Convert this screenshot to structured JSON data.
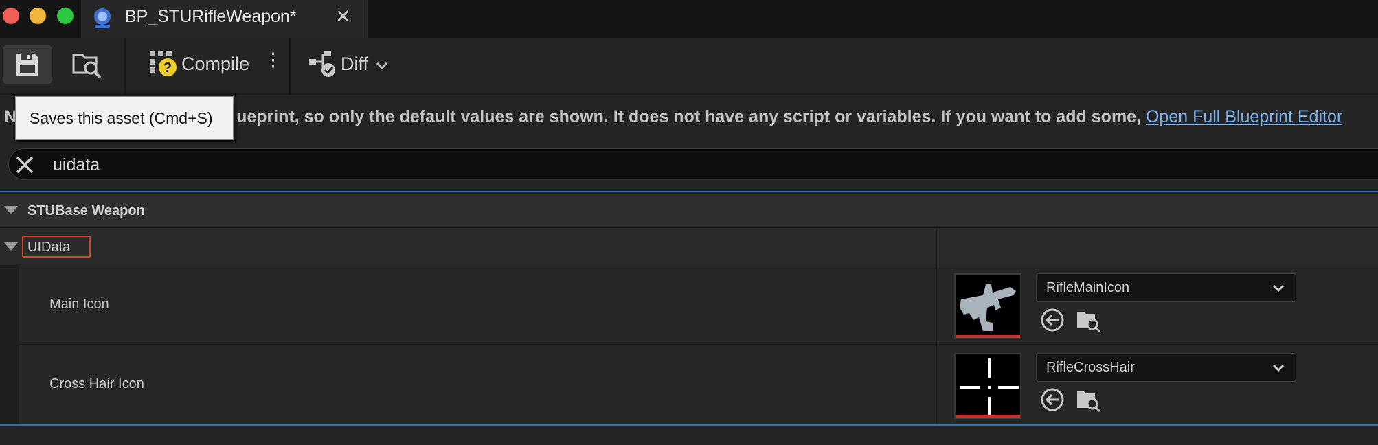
{
  "window": {
    "tab_title": "BP_STURifleWeapon*",
    "tab_close": "✕",
    "traffic_colors": [
      "#ee5f57",
      "#f2b53b",
      "#2bc840"
    ]
  },
  "toolbar": {
    "compile_label": "Compile",
    "diff_label": "Diff",
    "more_label": "⋮"
  },
  "tooltip": {
    "text": "Saves this asset (Cmd+S)"
  },
  "banner": {
    "lead": "N",
    "text": "ueprint, so only the default values are shown.  It does not have any script or variables.  If you want to add some, ",
    "link": "Open Full Blueprint Editor"
  },
  "search": {
    "value": "uidata",
    "placeholder": ""
  },
  "details": {
    "category": "STUBase Weapon",
    "subcategory": "UIData",
    "rows": [
      {
        "label": "Main Icon",
        "asset": "RifleMainIcon",
        "thumbnail": "rifle-silhouette"
      },
      {
        "label": "Cross Hair Icon",
        "asset": "RifleCrossHair",
        "thumbnail": "crosshair"
      }
    ]
  },
  "colors": {
    "accent_blue": "#2f6db5",
    "highlight_red": "#d64a2c",
    "link": "#7ab3f0"
  }
}
